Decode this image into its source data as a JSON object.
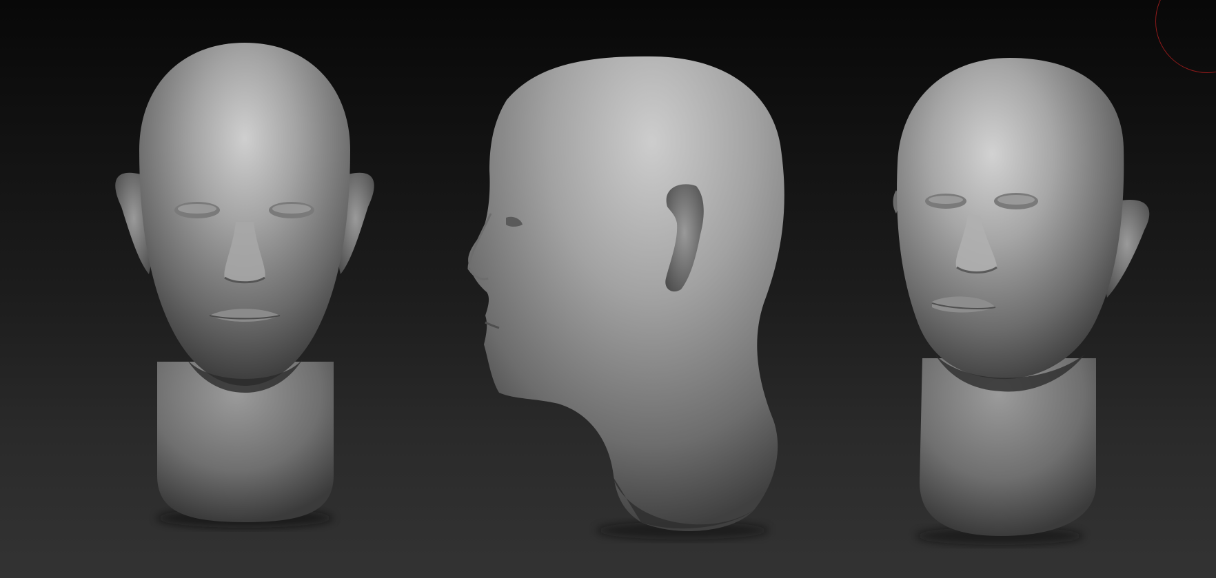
{
  "viewport": {
    "views": [
      {
        "name": "front",
        "description": ""
      },
      {
        "name": "side",
        "description": ""
      },
      {
        "name": "three-quarter",
        "description": ""
      }
    ],
    "colors": {
      "background_top": "#080808",
      "background_bottom": "#333333",
      "clay_light": "#c8c8c8",
      "clay_mid": "#8e8e8e",
      "clay_dark": "#3f3f3f",
      "brush_cursor": "#8f1a1a"
    }
  }
}
